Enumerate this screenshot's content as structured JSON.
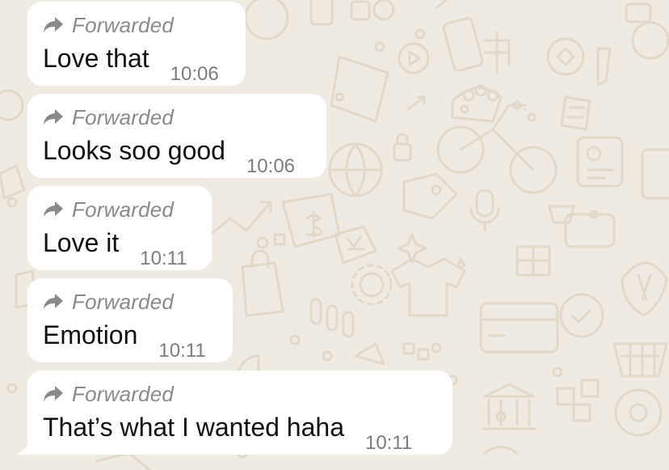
{
  "theme": {
    "background": "#efeae2",
    "bubble": "#ffffff",
    "forwarded_color": "#8a8a8a",
    "time_color": "#7d7d7d",
    "text_color": "#111111",
    "doodle_color": "#e2d8c8"
  },
  "messages": [
    {
      "forwarded_label": "Forwarded",
      "text": "Love that",
      "time": "10:06",
      "icon": "forward-arrow-icon"
    },
    {
      "forwarded_label": "Forwarded",
      "text": "Looks soo good",
      "time": "10:06",
      "icon": "forward-arrow-icon"
    },
    {
      "forwarded_label": "Forwarded",
      "text": "Love it",
      "time": "10:11",
      "icon": "forward-arrow-icon"
    },
    {
      "forwarded_label": "Forwarded",
      "text": "Emotion",
      "time": "10:11",
      "icon": "forward-arrow-icon"
    },
    {
      "forwarded_label": "Forwarded",
      "text": "That’s what I wanted haha",
      "time": "10:11",
      "icon": "forward-arrow-icon"
    }
  ]
}
